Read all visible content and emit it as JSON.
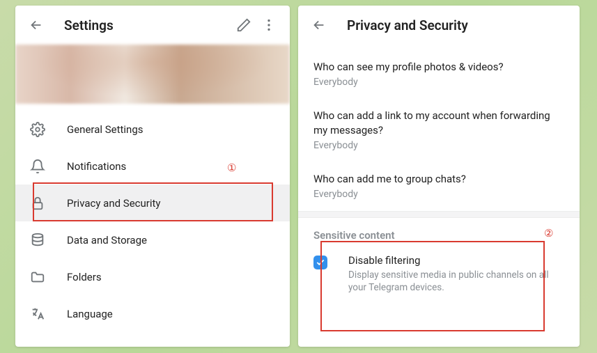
{
  "settings": {
    "title": "Settings",
    "items": [
      {
        "key": "general",
        "label": "General Settings"
      },
      {
        "key": "notifications",
        "label": "Notifications"
      },
      {
        "key": "privacy",
        "label": "Privacy and Security"
      },
      {
        "key": "data",
        "label": "Data and Storage"
      },
      {
        "key": "folders",
        "label": "Folders"
      },
      {
        "key": "language",
        "label": "Language"
      }
    ]
  },
  "privacy": {
    "title": "Privacy and Security",
    "items": [
      {
        "question": "Who can see my profile photos & videos?",
        "value": "Everybody"
      },
      {
        "question": "Who can add a link to my account when forwarding my messages?",
        "value": "Everybody"
      },
      {
        "question": "Who can add me to group chats?",
        "value": "Everybody"
      }
    ],
    "sensitive": {
      "section_title": "Sensitive content",
      "label": "Disable filtering",
      "description": "Display sensitive media in public channels on all your Telegram devices.",
      "checked": true
    }
  },
  "annotations": {
    "label1": "①",
    "label2": "②"
  }
}
